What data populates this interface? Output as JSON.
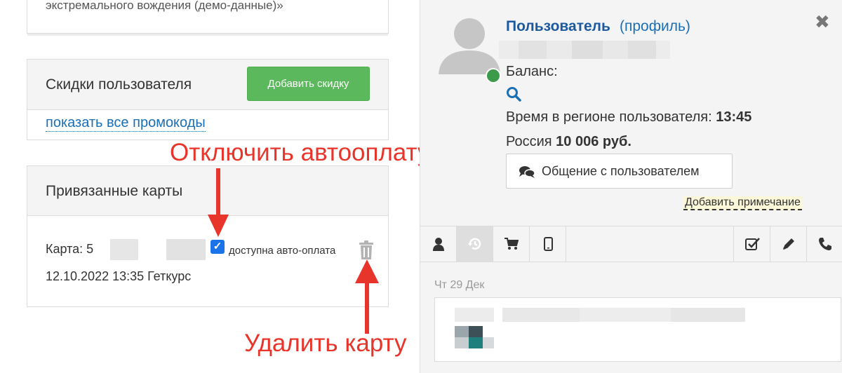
{
  "left": {
    "top_card_text": "экстремального вождения (демо-данные)»",
    "discounts": {
      "title": "Скидки пользователя",
      "add_button": "Добавить скидку",
      "show_promos_link": "показать все промокоды"
    },
    "cards": {
      "title": "Привязанные карты",
      "card_prefix": "Карта: 5",
      "autopay_checked": true,
      "autopay_label": "доступна авто-оплата",
      "date_line": "12.10.2022 13:35 Геткурс"
    },
    "annotations": {
      "disable_autopay": "Отключить автооплату",
      "delete_card": "Удалить карту"
    }
  },
  "profile": {
    "name": "Пользователь",
    "profile_link": "(профиль)",
    "close_icon": "close-icon",
    "online_color": "#3c9a4b",
    "balance_label": "Баланс:",
    "time_label": "Время в регионе пользователя:",
    "time_value": "13:45",
    "country": "Россия",
    "amount": "10 006 руб.",
    "chat_button": "Общение с пользователем",
    "add_note": "Добавить примечание"
  },
  "tabs": [
    {
      "icon": "user-icon",
      "active": false
    },
    {
      "icon": "history-icon",
      "active": true
    },
    {
      "icon": "cart-icon",
      "active": false
    },
    {
      "icon": "mobile-icon",
      "active": false
    },
    {
      "icon": "checkbox-icon",
      "active": false
    },
    {
      "icon": "pencil-icon",
      "active": false
    },
    {
      "icon": "phone-icon",
      "active": false
    }
  ],
  "feed": {
    "day_label": "Чт 29 Дек"
  },
  "colors": {
    "accent_blue": "#1b6fb5",
    "green_button": "#5cb85c",
    "annotation_red": "#e8352b"
  }
}
